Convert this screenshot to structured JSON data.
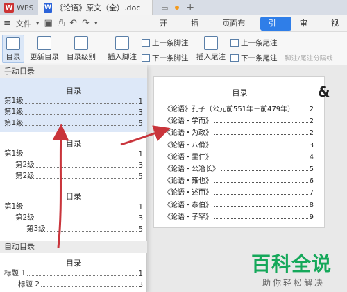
{
  "titlebar": {
    "app_label": "WPS",
    "doc_tab_label": "《论语》原文（全）.doc"
  },
  "menubar": {
    "file_label": "文件",
    "tabs": [
      "开始",
      "插入",
      "页面布局",
      "引用",
      "审阅",
      "视"
    ],
    "active_tab": "引用"
  },
  "ribbon": {
    "toc_label": "目录",
    "update_toc_label": "更新目录",
    "toc_level_label": "目录级别",
    "insert_footnote_label": "插入脚注",
    "prev_footnote_label": "上一条脚注",
    "next_footnote_label": "下一条脚注",
    "insert_endnote_label": "插入尾注",
    "prev_endnote_label": "上一条尾注",
    "next_endnote_label": "下一条尾注",
    "footnote_separator_label": "脚注/尾注分隔线"
  },
  "panel": {
    "manual_header": "手动目录",
    "auto_header": "自动目录",
    "templates": [
      {
        "title": "目录",
        "lines": [
          {
            "label": "第1级",
            "page": "1"
          },
          {
            "label": "第1级",
            "page": "3"
          },
          {
            "label": "第1级",
            "page": "5"
          }
        ]
      },
      {
        "title": "目录",
        "lines": [
          {
            "label": "第1级",
            "page": "1"
          },
          {
            "label": "第2级",
            "page": "3"
          },
          {
            "label": "第2级",
            "page": "5"
          }
        ]
      },
      {
        "title": "目录",
        "lines": [
          {
            "label": "第1级",
            "page": "1"
          },
          {
            "label": "第2级",
            "page": "3"
          },
          {
            "label": "第3级",
            "page": "5"
          }
        ]
      },
      {
        "title": "目录",
        "lines": [
          {
            "label": "标题 1",
            "page": "1"
          },
          {
            "label": "标题 2",
            "page": "3"
          }
        ]
      }
    ]
  },
  "document": {
    "toc_title": "目录",
    "entries": [
      {
        "label": "《论语》孔子（公元前551年－前479年）",
        "page": "2"
      },
      {
        "label": "《论语・学而》",
        "page": "2"
      },
      {
        "label": "《论语・为政》",
        "page": "2"
      },
      {
        "label": "《论语・八佾》",
        "page": "3"
      },
      {
        "label": "《论语・里仁》",
        "page": "4"
      },
      {
        "label": "《论语・公冶长》",
        "page": "5"
      },
      {
        "label": "《论语・雍也》",
        "page": "6"
      },
      {
        "label": "《论语・述而》",
        "page": "7"
      },
      {
        "label": "《论语・泰伯》",
        "page": "8"
      },
      {
        "label": "《论语・子罕》",
        "page": "9"
      }
    ],
    "side_mark": "&"
  },
  "watermark": {
    "logo_text": "百科全说",
    "sub_text": "助你轻松解决"
  },
  "colors": {
    "accent": "#2f7ee8",
    "arrow": "#c9343b",
    "watermark_green": "#15a85a"
  }
}
